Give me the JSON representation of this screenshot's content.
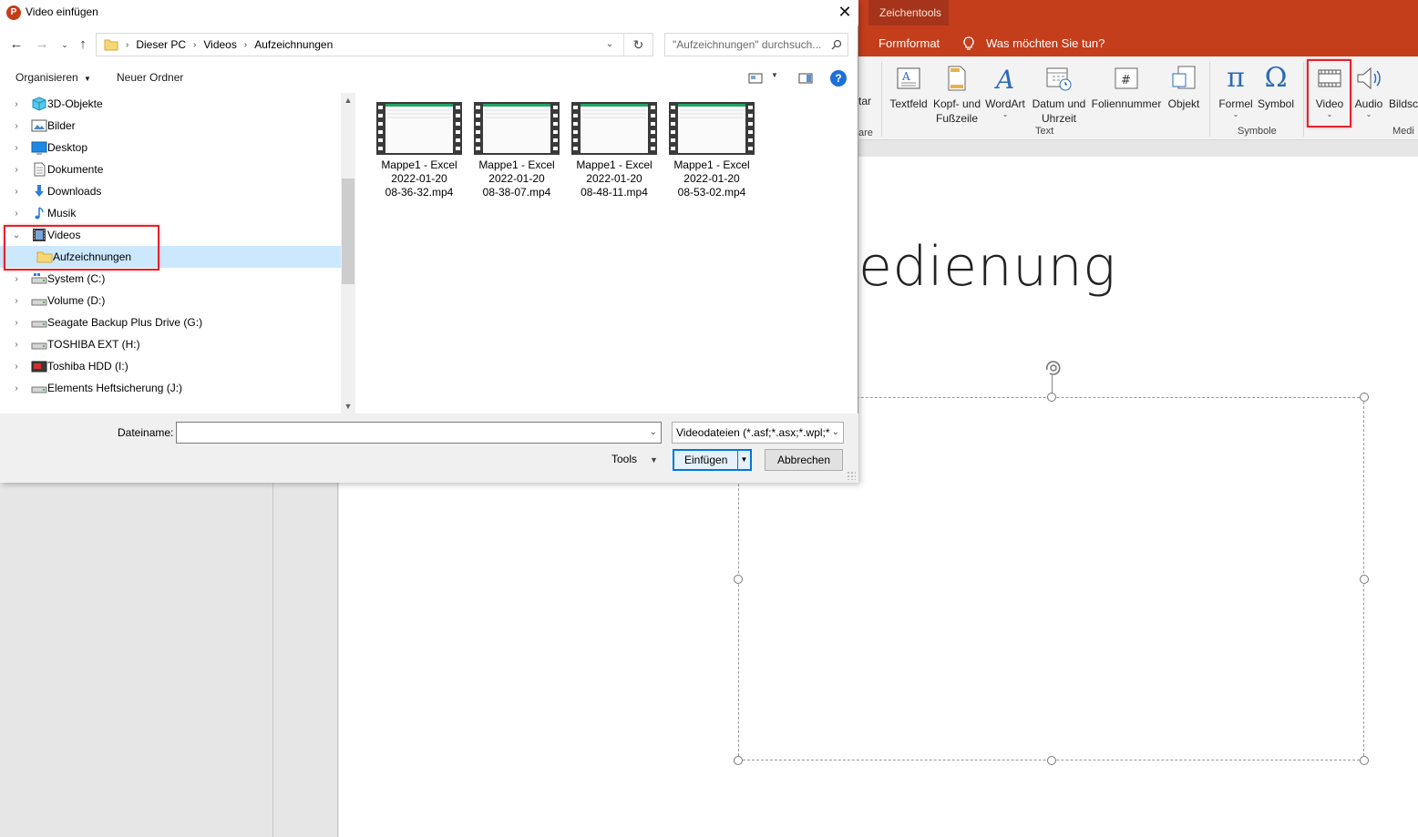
{
  "dialog": {
    "title": "Video einfügen",
    "close": "✕",
    "breadcrumb": [
      "Dieser PC",
      "Videos",
      "Aufzeichnungen"
    ],
    "search_placeholder": "\"Aufzeichnungen\" durchsuch...",
    "toolbar": {
      "organize": "Organisieren",
      "new_folder": "Neuer Ordner"
    },
    "tree": [
      {
        "label": "3D-Objekte",
        "icon": "cube-icon",
        "expand": "›"
      },
      {
        "label": "Bilder",
        "icon": "pictures-icon",
        "expand": "›"
      },
      {
        "label": "Desktop",
        "icon": "desktop-icon",
        "expand": "›"
      },
      {
        "label": "Dokumente",
        "icon": "documents-icon",
        "expand": "›"
      },
      {
        "label": "Downloads",
        "icon": "download-icon",
        "expand": "›"
      },
      {
        "label": "Musik",
        "icon": "music-icon",
        "expand": "›"
      },
      {
        "label": "Videos",
        "icon": "film-icon",
        "expand": "⌄"
      },
      {
        "label": "Aufzeichnungen",
        "icon": "folder-icon",
        "expand": ""
      },
      {
        "label": "System (C:)",
        "icon": "system-drive-icon",
        "expand": "›"
      },
      {
        "label": "Volume (D:)",
        "icon": "drive-icon",
        "expand": "›"
      },
      {
        "label": "Seagate Backup Plus Drive (G:)",
        "icon": "drive-icon",
        "expand": "›"
      },
      {
        "label": "TOSHIBA EXT (H:)",
        "icon": "drive-icon",
        "expand": "›"
      },
      {
        "label": "Toshiba HDD (I:)",
        "icon": "drive-red-icon",
        "expand": "›"
      },
      {
        "label": "Elements Heftsicherung (J:)",
        "icon": "drive-icon",
        "expand": "›"
      }
    ],
    "files": [
      {
        "line1": "Mappe1 - Excel",
        "line2": "2022-01-20",
        "line3": "08-36-32.mp4"
      },
      {
        "line1": "Mappe1 - Excel",
        "line2": "2022-01-20",
        "line3": "08-38-07.mp4"
      },
      {
        "line1": "Mappe1 - Excel",
        "line2": "2022-01-20",
        "line3": "08-48-11.mp4"
      },
      {
        "line1": "Mappe1 - Excel",
        "line2": "2022-01-20",
        "line3": "08-53-02.mp4"
      }
    ],
    "filename_label": "Dateiname:",
    "filename_value": "",
    "filter": "Videodateien (*.asf;*.asx;*.wpl;*",
    "tools": "Tools",
    "insert": "Einfügen",
    "cancel": "Abbrechen"
  },
  "ppt": {
    "contextual_tab": "Zeichentools",
    "format_tab": "Formformat",
    "tell_me": "Was möchten Sie tun?",
    "ribbon_cut_label": "tar",
    "ribbon_cut_group": "are",
    "ribbon": [
      {
        "label": "Textfeld",
        "icon": "textbox-icon"
      },
      {
        "label": "Kopf- und Fußzeile",
        "label2": "Fußzeile",
        "label1": "Kopf- und",
        "icon": "header-footer-icon"
      },
      {
        "label": "WordArt",
        "icon": "wordart-icon"
      },
      {
        "label1": "Datum und",
        "label2": "Uhrzeit",
        "icon": "date-time-icon"
      },
      {
        "label": "Foliennummer",
        "icon": "slide-number-icon"
      },
      {
        "label": "Objekt",
        "icon": "object-icon"
      },
      {
        "label": "Formel",
        "icon": "pi-icon"
      },
      {
        "label": "Symbol",
        "icon": "omega-icon"
      },
      {
        "label": "Video",
        "icon": "video-icon"
      },
      {
        "label": "Audio",
        "icon": "audio-icon"
      },
      {
        "label": "Bildsc",
        "icon": "screen-icon"
      }
    ],
    "groups": {
      "text": "Text",
      "symbols": "Symbole",
      "media": "Medi"
    },
    "slide_title": "edienung",
    "accent": "#c43e1c",
    "highlight": "#e0242e"
  }
}
